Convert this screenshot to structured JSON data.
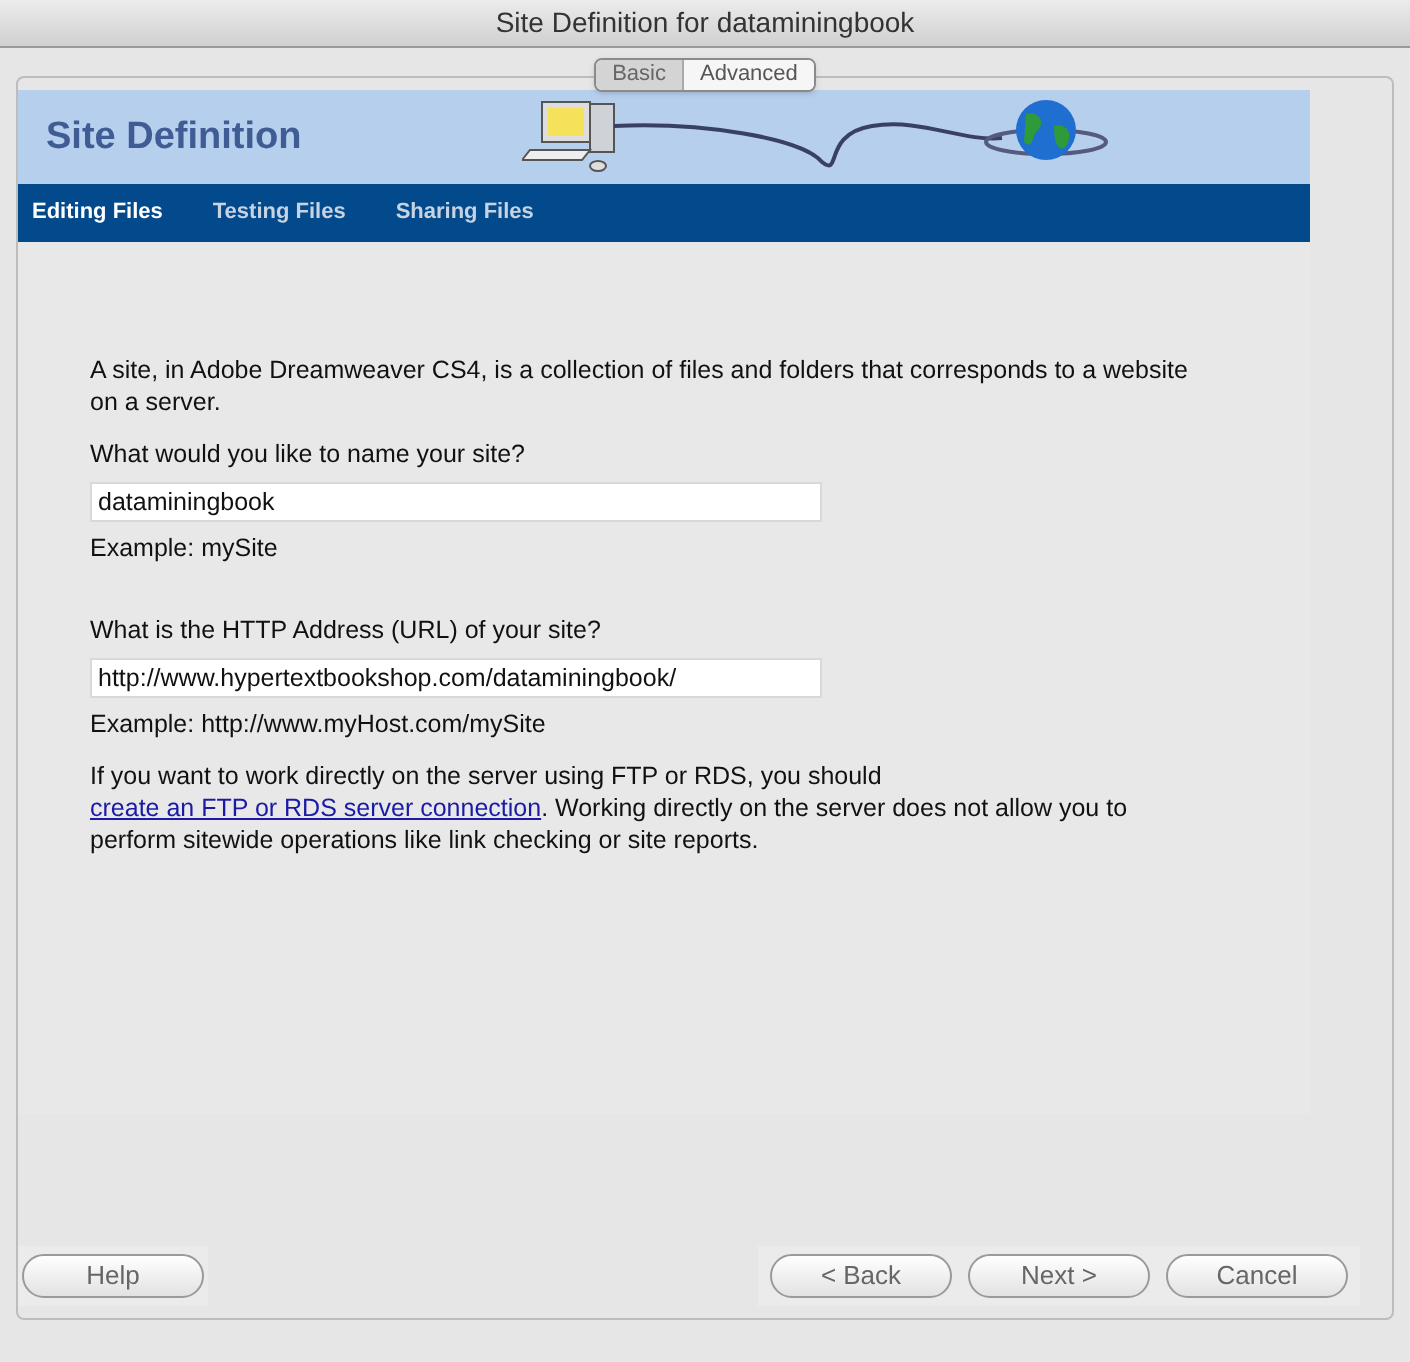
{
  "window": {
    "title": "Site Definition for dataminingbook"
  },
  "mode_tabs": [
    {
      "label": "Basic",
      "selected": true
    },
    {
      "label": "Advanced",
      "selected": false
    }
  ],
  "banner": {
    "title": "Site Definition"
  },
  "nav_tabs": [
    {
      "label": "Editing Files",
      "selected": true
    },
    {
      "label": "Testing Files",
      "selected": false
    },
    {
      "label": "Sharing Files",
      "selected": false
    }
  ],
  "intro": "A site, in Adobe Dreamweaver CS4, is a collection of files and folders that corresponds to a website on a server.",
  "fields": [
    {
      "label": "What would you like to name your site?",
      "value": "dataminingbook",
      "example": "Example: mySite"
    },
    {
      "label": "What is the HTTP Address (URL) of your site?",
      "value": "http://www.hypertextbookshop.com/dataminingbook/",
      "example": "Example: http://www.myHost.com/mySite"
    }
  ],
  "note": {
    "before": "If you want to work directly on the server using FTP or RDS, you should ",
    "link": "create an FTP or RDS server connection",
    "after": ".  Working directly on the server does not allow you to perform sitewide operations like link checking or site reports."
  },
  "buttons_left": [
    "Help"
  ],
  "buttons_right": [
    "< Back",
    "Next >",
    "Cancel"
  ]
}
